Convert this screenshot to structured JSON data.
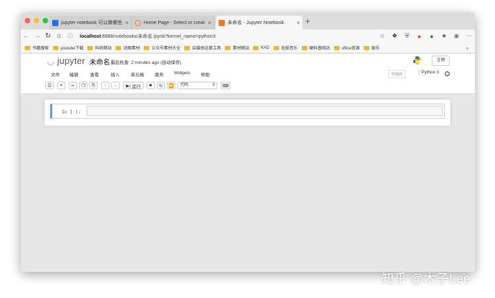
{
  "tabs": [
    {
      "label": "jupyter notebook 可以做哪些事…",
      "icon": "zhihu-icon",
      "close": "×"
    },
    {
      "label": "Home Page - Select or create a…",
      "icon": "jupyter-tab-icon",
      "close": "×"
    },
    {
      "label": "未命名 - Jupyter Notebook",
      "icon": "notebook-tab-icon",
      "close": "×"
    }
  ],
  "new_tab": "+",
  "address": {
    "host": "localhost",
    "rest": ":8888/notebooks/未命名.ipynb?kernel_name=python3"
  },
  "bookmarks": [
    "书籍搜索",
    "youtube下载",
    "科研网站",
    "动图素材",
    "公众号素材大全",
    "自媒体运营工具",
    "素材网站",
    "KAD",
    "无损音乐",
    "硬科普网站",
    "office资源",
    "娱乐"
  ],
  "jupyter": {
    "logo_text": "jupyter",
    "notebook_title": "未命名",
    "checkpoint": "最后检查: 2 minutes ago  (自动保存)",
    "logout": "注销"
  },
  "menu": [
    "文件",
    "编辑",
    "查看",
    "插入",
    "单元格",
    "服务",
    "Widgets",
    "帮助"
  ],
  "trusted": "可信的",
  "kernel_name": "Python 3",
  "toolbar": {
    "run_label": "运行",
    "cell_type": "代码"
  },
  "cell": {
    "prompt": "In [ ]:"
  },
  "watermark": "知乎 @木子Lee",
  "colors": {
    "accent": "#f37726",
    "cell_border": "#42a5f5"
  }
}
